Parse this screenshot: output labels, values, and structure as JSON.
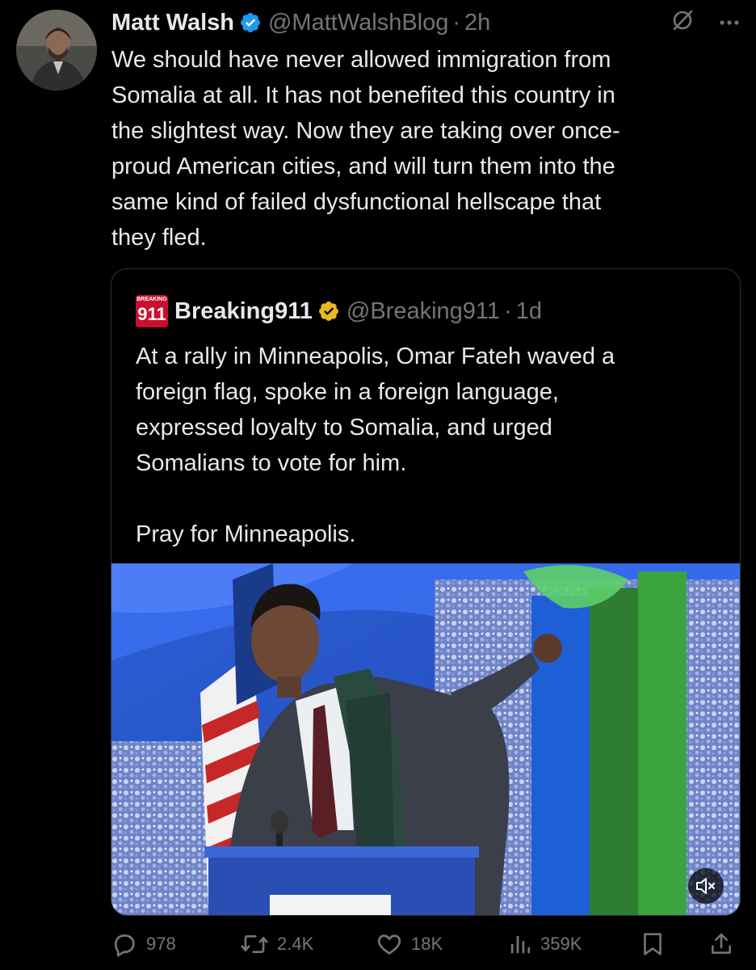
{
  "author": {
    "name": "Matt Walsh",
    "handle": "@MattWalshBlog",
    "dot": "·",
    "time": "2h",
    "verified_color": "#1d9bf0"
  },
  "tweet": {
    "text": "We should have never allowed immigration from\nSomalia at all. It has not benefited this country in\nthe slightest way. Now they are taking over once-\nproud American cities, and will turn them into the\nsame kind of failed dysfunctional hellscape that\nthey fled."
  },
  "quote": {
    "logo_top": "BREAKING",
    "logo_num": "911",
    "logo_color": "#c8102e",
    "name": "Breaking911",
    "handle": "@Breaking911",
    "dot": "·",
    "time": "1d",
    "verified_color": "#e8b923",
    "paragraph1": "At a rally in Minneapolis, Omar Fateh waved a\nforeign flag, spoke in a foreign language,\nexpressed loyalty to Somalia, and urged\nSomalians to vote for him.",
    "paragraph2": "Pray for Minneapolis."
  },
  "media": {
    "type": "video",
    "muted": true,
    "icon": "speaker-muted-icon"
  },
  "actions": {
    "replies": "978",
    "reposts": "2.4K",
    "likes": "18K",
    "views": "359K",
    "reply_icon": "reply-icon",
    "repost_icon": "repost-icon",
    "like_icon": "heart-icon",
    "views_icon": "views-icon",
    "bookmark_icon": "bookmark-icon",
    "share_icon": "share-icon"
  },
  "colors": {
    "background": "#000000",
    "text": "#e7e9ea",
    "muted_text": "#71767b",
    "border": "#2f3336"
  }
}
